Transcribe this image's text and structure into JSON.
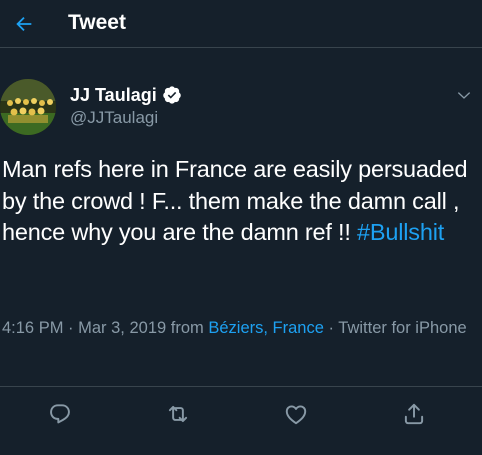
{
  "header": {
    "title": "Tweet",
    "back_icon": "arrow-left-icon"
  },
  "author": {
    "name": "JJ Taulagi",
    "handle": "@JJTaulagi",
    "verified": true,
    "avatar_icon": "team-photo-avatar"
  },
  "tweet": {
    "text_main": "Man refs here in France are easily persuaded by the crowd ! F... them make the damn call , hence why you are the damn ref !! ",
    "hashtag": "#Bullshit"
  },
  "meta": {
    "time": "4:16 PM",
    "sep1": " · ",
    "date": "Mar 3, 2019",
    "from_word": " from ",
    "location": "Béziers, France",
    "sep2": " · ",
    "client": "Twitter for iPhone"
  },
  "actions": {
    "reply_icon": "reply-icon",
    "retweet_icon": "retweet-icon",
    "like_icon": "heart-icon",
    "share_icon": "share-icon"
  },
  "colors": {
    "background": "#15202b",
    "accent": "#1da1f2",
    "secondary_text": "#8899a6",
    "divider": "#38444d"
  }
}
